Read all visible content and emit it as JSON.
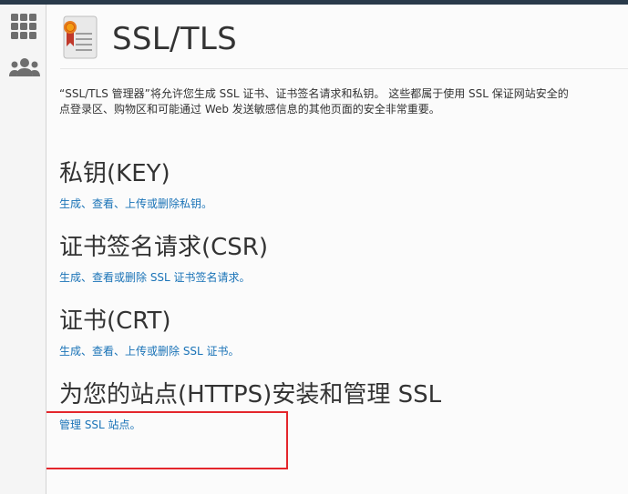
{
  "header": {
    "title": "SSL/TLS"
  },
  "description": {
    "line1": "“SSL/TLS 管理器”将允许您生成 SSL 证书、证书签名请求和私钥。 这些都属于使用 SSL 保证网站安全的",
    "line2": "点登录区、购物区和可能通过 Web 发送敏感信息的其他页面的安全非常重要。"
  },
  "sections": [
    {
      "title": "私钥(KEY)",
      "link": "生成、查看、上传或删除私钥。"
    },
    {
      "title": "证书签名请求(CSR)",
      "link": "生成、查看或删除 SSL 证书签名请求。"
    },
    {
      "title": "证书(CRT)",
      "link": "生成、查看、上传或删除 SSL 证书。"
    },
    {
      "title": "为您的站点(HTTPS)安装和管理 SSL",
      "link": "管理 SSL 站点。"
    }
  ],
  "icons": {
    "sidebar_top": "grid-icon",
    "sidebar_second": "users-icon",
    "page": "certificate-icon"
  },
  "colors": {
    "link": "#1a73b7",
    "topbar": "#293a4a",
    "highlight": "#e4262c"
  }
}
